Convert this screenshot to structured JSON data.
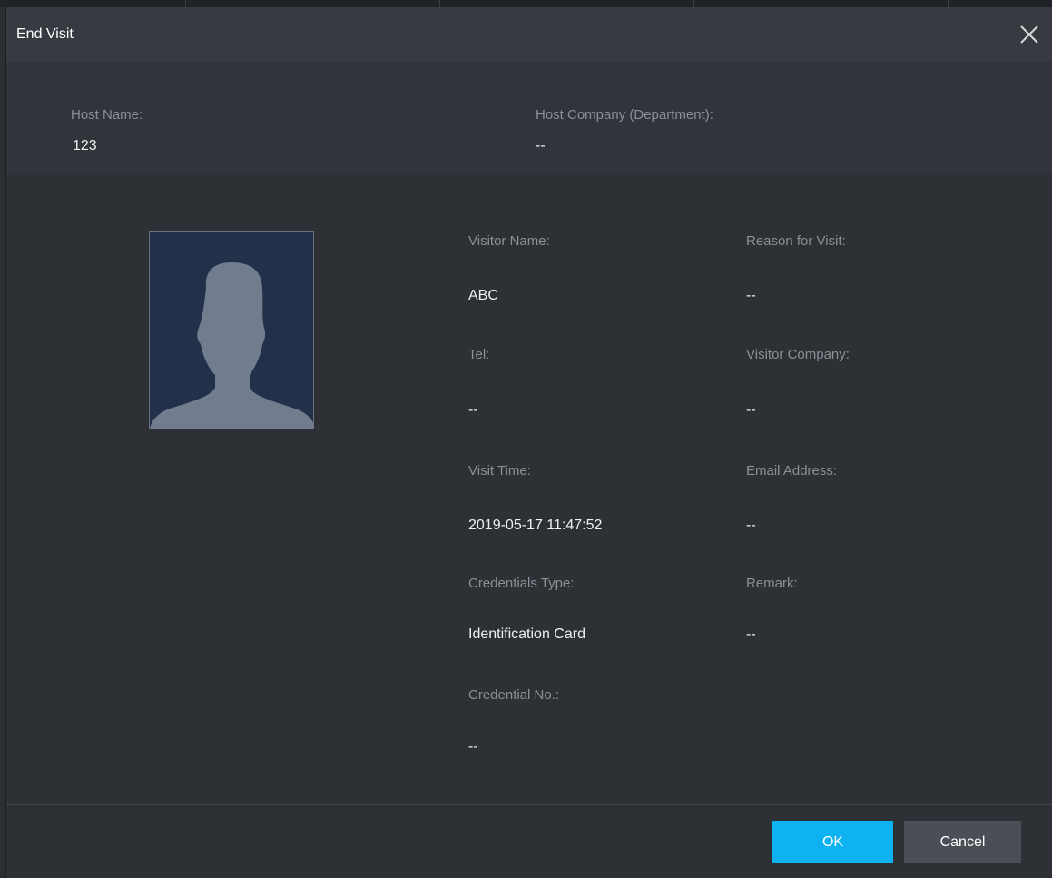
{
  "dialog": {
    "title": "End Visit",
    "close_icon": "close-icon"
  },
  "host": {
    "name_label": "Host Name:",
    "name_value": "123",
    "company_label": "Host Company (Department):",
    "company_value": "--"
  },
  "visitor": {
    "photo_icon": "person-silhouette-icon",
    "fields": {
      "visitor_name": {
        "label": "Visitor Name:",
        "value": "ABC"
      },
      "reason": {
        "label": "Reason for Visit:",
        "value": "--"
      },
      "tel": {
        "label": "Tel:",
        "value": "--"
      },
      "visitor_company": {
        "label": "Visitor Company:",
        "value": "--"
      },
      "visit_time": {
        "label": "Visit Time:",
        "value": "2019-05-17 11:47:52"
      },
      "email": {
        "label": "Email Address:",
        "value": "--"
      },
      "credentials_type": {
        "label": "Credentials Type:",
        "value": "Identification Card"
      },
      "remark": {
        "label": "Remark:",
        "value": "--"
      },
      "credential_no": {
        "label": "Credential No.:",
        "value": "--"
      }
    }
  },
  "footer": {
    "ok_label": "OK",
    "cancel_label": "Cancel"
  },
  "colors": {
    "accent": "#0fb2f1",
    "dialog_bg": "#2d3035",
    "titlebar_bg": "#373a40",
    "label": "#8c9096",
    "value": "#f0f0f0"
  }
}
